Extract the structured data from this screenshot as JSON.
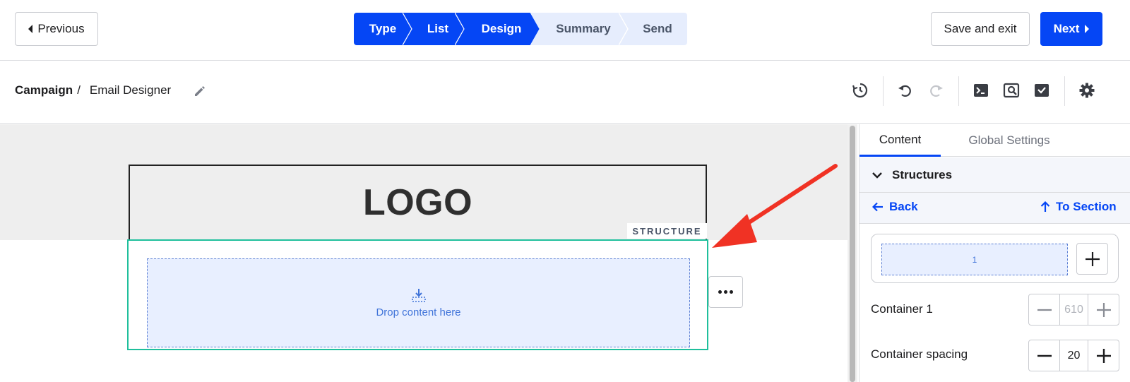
{
  "topbar": {
    "previous_label": "Previous",
    "steps": [
      {
        "label": "Type",
        "state": "done"
      },
      {
        "label": "List",
        "state": "done"
      },
      {
        "label": "Design",
        "state": "current"
      },
      {
        "label": "Summary",
        "state": "upcoming"
      },
      {
        "label": "Send",
        "state": "upcoming"
      }
    ],
    "save_exit_label": "Save and exit",
    "next_label": "Next"
  },
  "breadcrumb": {
    "parent": "Campaign",
    "separator": "/",
    "current": "Email Designer"
  },
  "toolbar": {
    "icons": [
      "history-icon",
      "undo-icon",
      "redo-icon",
      "code-icon",
      "preview-icon",
      "test-check-icon",
      "settings-icon"
    ]
  },
  "canvas": {
    "logo_text": "LOGO",
    "structure_tag": "STRUCTURE",
    "drop_text": "Drop content here"
  },
  "panel": {
    "tabs": [
      "Content",
      "Global Settings"
    ],
    "active_tab": "Content",
    "section_title": "Structures",
    "back_label": "Back",
    "to_section_label": "To Section",
    "column_label": "1",
    "container_label": "Container 1",
    "container_value": "610",
    "spacing_label": "Container spacing",
    "spacing_value": "20"
  },
  "colors": {
    "accent": "#0546f5",
    "step_inactive_bg": "#e6edfd",
    "structure_border": "#1fbf9c",
    "dropzone_bg": "#e8efff",
    "annotation_arrow": "#f03224"
  }
}
